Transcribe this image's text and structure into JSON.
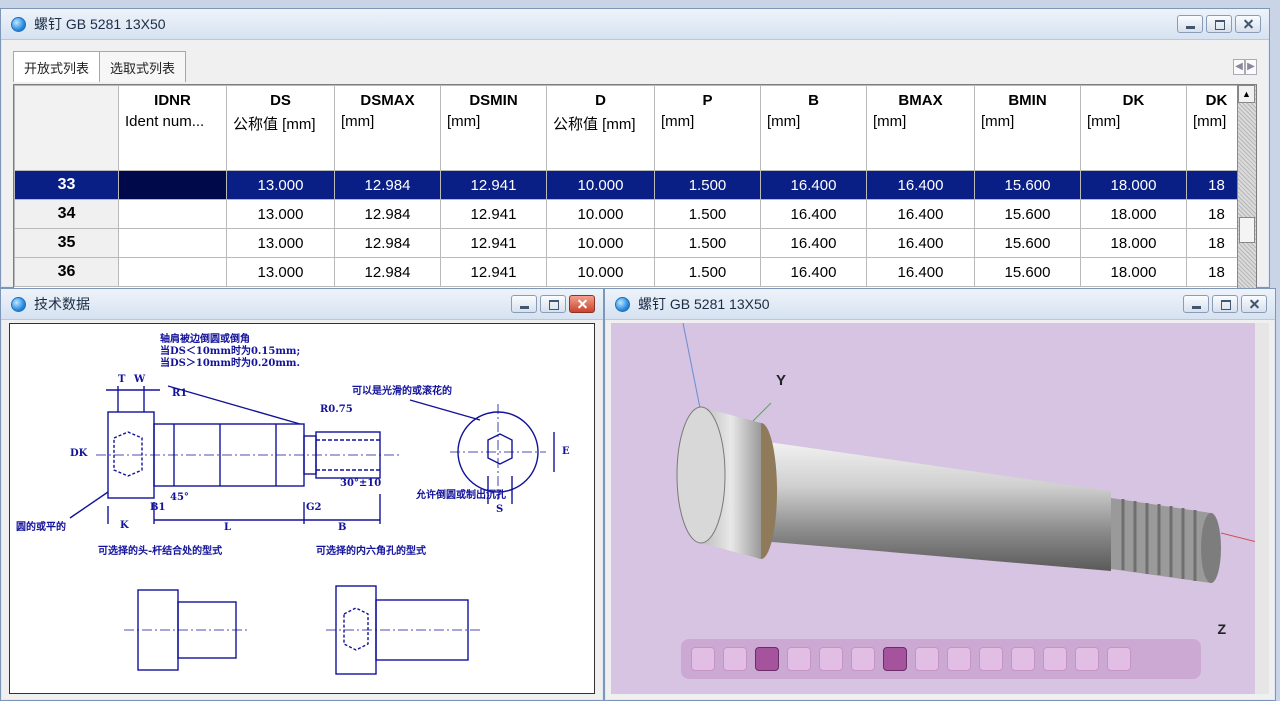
{
  "top_window": {
    "title": "螺钉 GB 5281 13X50",
    "tabs": [
      {
        "label": "开放式列表",
        "active": true
      },
      {
        "label": "选取式列表",
        "active": false
      }
    ],
    "columns": [
      {
        "name": "IDNR",
        "unit": "Ident num..."
      },
      {
        "name": "DS",
        "unit": "公称值 [mm]"
      },
      {
        "name": "DSMAX",
        "unit": "[mm]"
      },
      {
        "name": "DSMIN",
        "unit": "[mm]"
      },
      {
        "name": "D",
        "unit": "公称值 [mm]"
      },
      {
        "name": "P",
        "unit": "[mm]"
      },
      {
        "name": "B",
        "unit": "[mm]"
      },
      {
        "name": "BMAX",
        "unit": "[mm]"
      },
      {
        "name": "BMIN",
        "unit": "[mm]"
      },
      {
        "name": "DK",
        "unit": "[mm]"
      },
      {
        "name": "DK",
        "unit": "[mm]"
      }
    ],
    "rows": [
      {
        "num": "33",
        "selected": true,
        "cells": [
          "",
          "13.000",
          "12.984",
          "12.941",
          "10.000",
          "1.500",
          "16.400",
          "16.400",
          "15.600",
          "18.000",
          "18"
        ]
      },
      {
        "num": "34",
        "selected": false,
        "cells": [
          "",
          "13.000",
          "12.984",
          "12.941",
          "10.000",
          "1.500",
          "16.400",
          "16.400",
          "15.600",
          "18.000",
          "18"
        ]
      },
      {
        "num": "35",
        "selected": false,
        "cells": [
          "",
          "13.000",
          "12.984",
          "12.941",
          "10.000",
          "1.500",
          "16.400",
          "16.400",
          "15.600",
          "18.000",
          "18"
        ]
      },
      {
        "num": "36",
        "selected": false,
        "cells": [
          "",
          "13.000",
          "12.984",
          "12.941",
          "10.000",
          "1.500",
          "16.400",
          "16.400",
          "15.600",
          "18.000",
          "18"
        ]
      }
    ],
    "selection_color": "#0a1f86"
  },
  "tech_window": {
    "title": "技术数据",
    "drawing_labels": {
      "note_title": "轴肩被边倒圆或倒角",
      "note_line1": "当DS＜10mm时为0.15mm;",
      "note_line2": "当DS＞10mm时为0.20mm.",
      "knurl_note": "可以是光滑的或滚花的",
      "head_joint": "可选择的头-杆结合处的型式",
      "hex_type": "可选择的内六角孔的型式",
      "undercut": "允许倒圆或制出沉孔",
      "flat": "圆的或平的",
      "dim_T": "T",
      "dim_W": "W",
      "dim_R1": "R1",
      "dim_R075": "R0.75",
      "dim_DK": "DK",
      "dim_S": "S",
      "dim_E": "E",
      "dim_B1": "B1",
      "dim_L": "L",
      "dim_B": "B",
      "dim_G2": "G2",
      "dim_K": "K",
      "dim_45": "45°",
      "dim_30": "30°±10"
    }
  },
  "view_window": {
    "title": "螺钉 GB 5281 13X50",
    "axis_y": "Y",
    "axis_z": "Z",
    "background": "#d6c4e2"
  }
}
